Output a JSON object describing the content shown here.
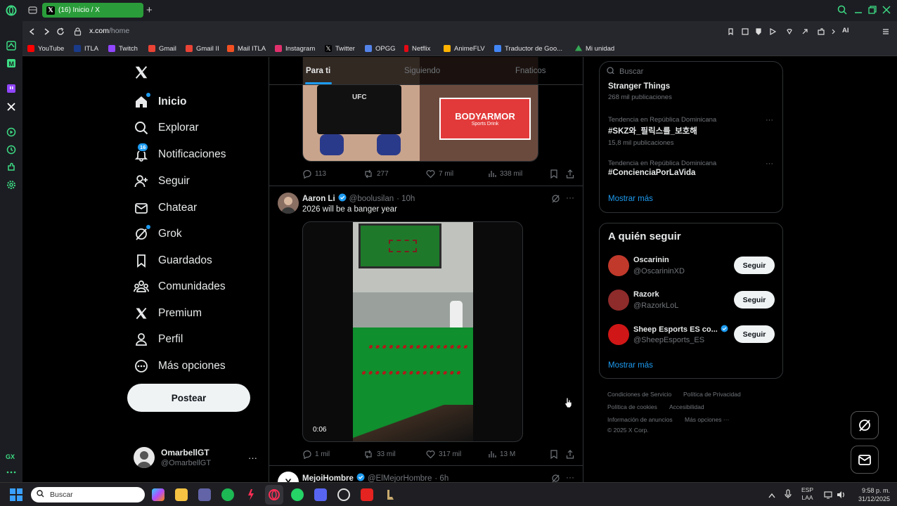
{
  "browser": {
    "tab_title": "(16) Inicio / X",
    "url_host": "x.com",
    "url_path": "/home",
    "ai_label": "AI"
  },
  "bookmarks": [
    {
      "label": "YouTube",
      "color": "#ff0000"
    },
    {
      "label": "ITLA",
      "color": "#1a3a8a"
    },
    {
      "label": "Twitch",
      "color": "#9146ff"
    },
    {
      "label": "Gmail",
      "color": "#ea4335"
    },
    {
      "label": "Gmail II",
      "color": "#ea4335"
    },
    {
      "label": "Mail ITLA",
      "color": "#f25022"
    },
    {
      "label": "Instagram",
      "color": "#e1306c"
    },
    {
      "label": "Twitter",
      "color": "#ffffff"
    },
    {
      "label": "OPGG",
      "color": "#5383e8"
    },
    {
      "label": "Netflix",
      "color": "#e50914"
    },
    {
      "label": "AnimeFLV",
      "color": "#ffb300"
    },
    {
      "label": "Traductor de Goo...",
      "color": "#4285f4"
    },
    {
      "label": "Mi unidad",
      "color": "#34a853"
    }
  ],
  "nav": {
    "items": [
      {
        "label": "Inicio",
        "icon": "home-icon"
      },
      {
        "label": "Explorar",
        "icon": "search-icon"
      },
      {
        "label": "Notificaciones",
        "icon": "bell-icon",
        "badge": "16"
      },
      {
        "label": "Seguir",
        "icon": "add-person-icon"
      },
      {
        "label": "Chatear",
        "icon": "mail-icon"
      },
      {
        "label": "Grok",
        "icon": "grok-icon"
      },
      {
        "label": "Guardados",
        "icon": "bookmark-icon"
      },
      {
        "label": "Comunidades",
        "icon": "communities-icon"
      },
      {
        "label": "Premium",
        "icon": "x-icon"
      },
      {
        "label": "Perfil",
        "icon": "person-icon"
      },
      {
        "label": "Más opciones",
        "icon": "more-circle-icon"
      }
    ],
    "post_label": "Postear",
    "account": {
      "name": "OmarbellGT",
      "handle": "@OmarbellGT"
    }
  },
  "feed": {
    "tabs": [
      "Para ti",
      "Siguiendo",
      "Fnaticos"
    ],
    "post1": {
      "sponsor_text": "BODYARMOR",
      "sponsor_sub": "Sports Drink",
      "ufc": "UFC",
      "replies": "113",
      "reposts": "277",
      "likes": "7 mil",
      "views": "338 mil"
    },
    "post2": {
      "author": "Aaron Li",
      "handle": "@boolusilan",
      "time": "· 10h",
      "text": "2026 will be a banger year",
      "video_time": "0:06",
      "replies": "1 mil",
      "reposts": "33 mil",
      "likes": "317 mil",
      "views": "13 M"
    },
    "post3": {
      "author": "MejoiHombre",
      "handle": "@ElMejorHombre",
      "time": "· 6h"
    }
  },
  "right": {
    "search_placeholder": "Buscar",
    "trends": [
      {
        "context": "",
        "title": "Stranger Things",
        "count": "268 mil publicaciones"
      },
      {
        "context": "Tendencia en República Dominicana",
        "title": "#SKZ와_필릭스를_보호해",
        "count": "15,8 mil publicaciones"
      },
      {
        "context": "Tendencia en República Dominicana",
        "title": "#ConcienciaPorLaVida",
        "count": ""
      }
    ],
    "show_more": "Mostrar más",
    "who_to_follow_title": "A quién seguir",
    "who_to_follow": [
      {
        "name": "Oscarinin",
        "handle": "@OscarininXD",
        "button": "Seguir",
        "avatar_color": "#c0392b"
      },
      {
        "name": "Razork",
        "handle": "@RazorkLoL",
        "button": "Seguir",
        "avatar_color": "#8e2b2b"
      },
      {
        "name": "Sheep Esports ES co...",
        "handle": "@SheepEsports_ES",
        "button": "Seguir",
        "avatar_color": "#d01616"
      }
    ],
    "show_more_2": "Mostrar más",
    "footer": [
      "Condiciones de Servicio",
      "Política de Privacidad",
      "Política de cookies",
      "Accesibilidad",
      "Información de anuncios",
      "Más opciones ···",
      "© 2025 X Corp."
    ]
  },
  "taskbar": {
    "search_placeholder": "Buscar",
    "lang_top": "ESP",
    "lang_bottom": "LAA",
    "time": "9:58 p. m.",
    "date": "31/12/2025"
  }
}
